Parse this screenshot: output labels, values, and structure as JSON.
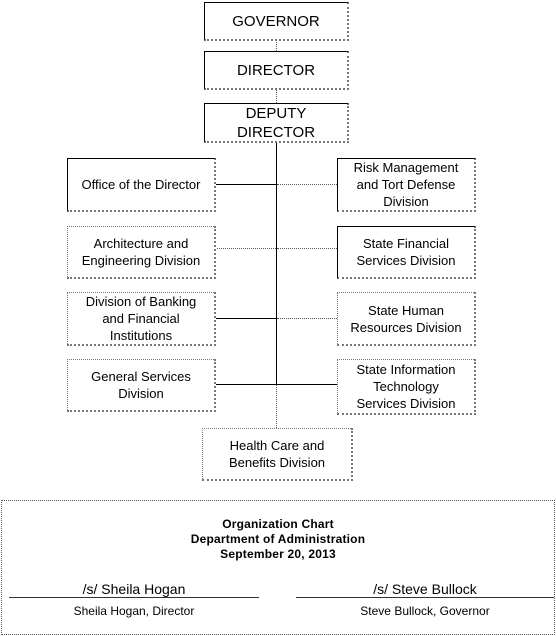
{
  "chart": {
    "top_chain": [
      {
        "id": "governor",
        "label": "GOVERNOR"
      },
      {
        "id": "director",
        "label": "DIRECTOR"
      },
      {
        "id": "deputy-director",
        "label": "DEPUTY\nDIRECTOR"
      }
    ],
    "left_divisions": [
      {
        "id": "office-of-the-director",
        "label": "Office of the Director"
      },
      {
        "id": "architecture-engineering",
        "label": "Architecture and\nEngineering Division"
      },
      {
        "id": "banking-financial",
        "label": "Division of Banking\nand Financial\nInstitutions"
      },
      {
        "id": "general-services",
        "label": "General Services\nDivision"
      }
    ],
    "right_divisions": [
      {
        "id": "risk-management",
        "label": "Risk Management\nand Tort Defense\nDivision"
      },
      {
        "id": "state-financial",
        "label": "State Financial\nServices Division"
      },
      {
        "id": "state-human-resources",
        "label": "State Human\nResources Division"
      },
      {
        "id": "state-information-technology",
        "label": "State Information\nTechnology\nServices Division"
      }
    ],
    "bottom": {
      "id": "health-care-benefits",
      "label": "Health Care and\nBenefits Division"
    }
  },
  "footer": {
    "title": "Organization Chart",
    "department": "Department of Administration",
    "date": "September 20, 2013",
    "signatures": [
      {
        "signature": "/s/ Sheila Hogan",
        "name_title": "Sheila Hogan, Director"
      },
      {
        "signature": "/s/ Steve Bullock",
        "name_title": "Steve Bullock, Governor"
      }
    ]
  }
}
